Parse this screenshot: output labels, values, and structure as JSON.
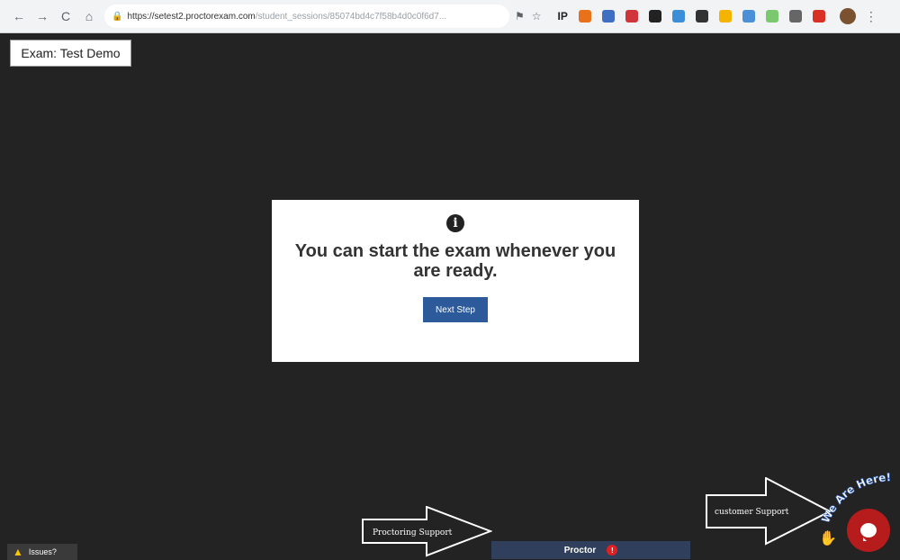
{
  "browser": {
    "back": "←",
    "forward": "→",
    "reload": "C",
    "home": "⌂",
    "lock": "🔒",
    "url_host": "https://setest2.proctorexam.com",
    "url_path": "/student_sessions/85074bd4c7f58b4d0c0f6d7...",
    "extensions": [
      {
        "label": "IP",
        "color": "#222222"
      },
      {
        "label": "",
        "color": "#e8711a"
      },
      {
        "label": "",
        "color": "#3f6fc2"
      },
      {
        "label": "",
        "color": "#d0353b"
      },
      {
        "label": "",
        "color": "#222222"
      },
      {
        "label": "",
        "color": "#3b8fd6"
      },
      {
        "label": "",
        "color": "#333333"
      },
      {
        "label": "",
        "color": "#f4b400"
      },
      {
        "label": "",
        "color": "#4a90d9"
      },
      {
        "label": "",
        "color": "#7bc96f"
      },
      {
        "label": "",
        "color": "#666666"
      },
      {
        "label": "",
        "color": "#d93025"
      }
    ]
  },
  "exam": {
    "label": "Exam: Test Demo"
  },
  "modal": {
    "message": "You can start the exam whenever you are ready.",
    "button": "Next Step"
  },
  "annotations": {
    "proctoring_support": "Proctoring Support",
    "customer_support": "customer Support"
  },
  "proctor_bar": {
    "label": "Proctor",
    "badge": "!"
  },
  "issues": {
    "label": "Issues?"
  },
  "support_widget": {
    "banner": "We Are Here!"
  }
}
